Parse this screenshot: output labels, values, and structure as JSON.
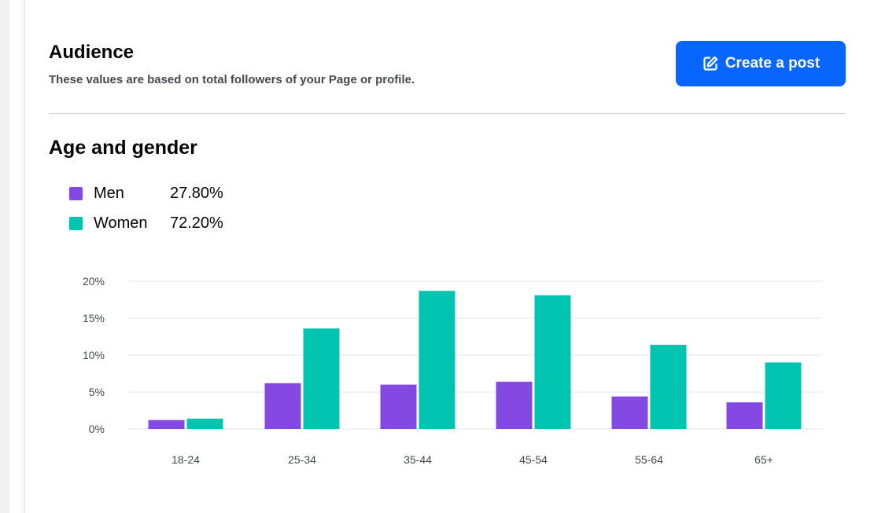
{
  "header": {
    "title": "Audience",
    "subtitle": "These values are based on total followers of your Page or profile."
  },
  "actions": {
    "create_post_label": "Create a post"
  },
  "section": {
    "title": "Age and gender"
  },
  "legend": [
    {
      "label": "Men",
      "value": "27.80%",
      "color": "#8549e3"
    },
    {
      "label": "Women",
      "value": "72.20%",
      "color": "#00c4b0"
    }
  ],
  "icons": {
    "create_post": "edit-icon"
  },
  "colors": {
    "accent": "#0866ff",
    "men": "#8549e3",
    "women": "#00c4b0"
  },
  "chart_data": {
    "type": "bar",
    "categories": [
      "18-24",
      "25-34",
      "35-44",
      "45-54",
      "55-64",
      "65+"
    ],
    "series": [
      {
        "name": "Men",
        "values": [
          1.2,
          6.2,
          6.0,
          6.4,
          4.4,
          3.6
        ]
      },
      {
        "name": "Women",
        "values": [
          1.4,
          13.6,
          18.7,
          18.1,
          11.4,
          9.0
        ]
      }
    ],
    "ylim": [
      0,
      20
    ],
    "yticks": [
      0,
      5,
      10,
      15,
      20
    ],
    "ytick_labels": [
      "0%",
      "5%",
      "10%",
      "15%",
      "20%"
    ],
    "grid": true
  }
}
